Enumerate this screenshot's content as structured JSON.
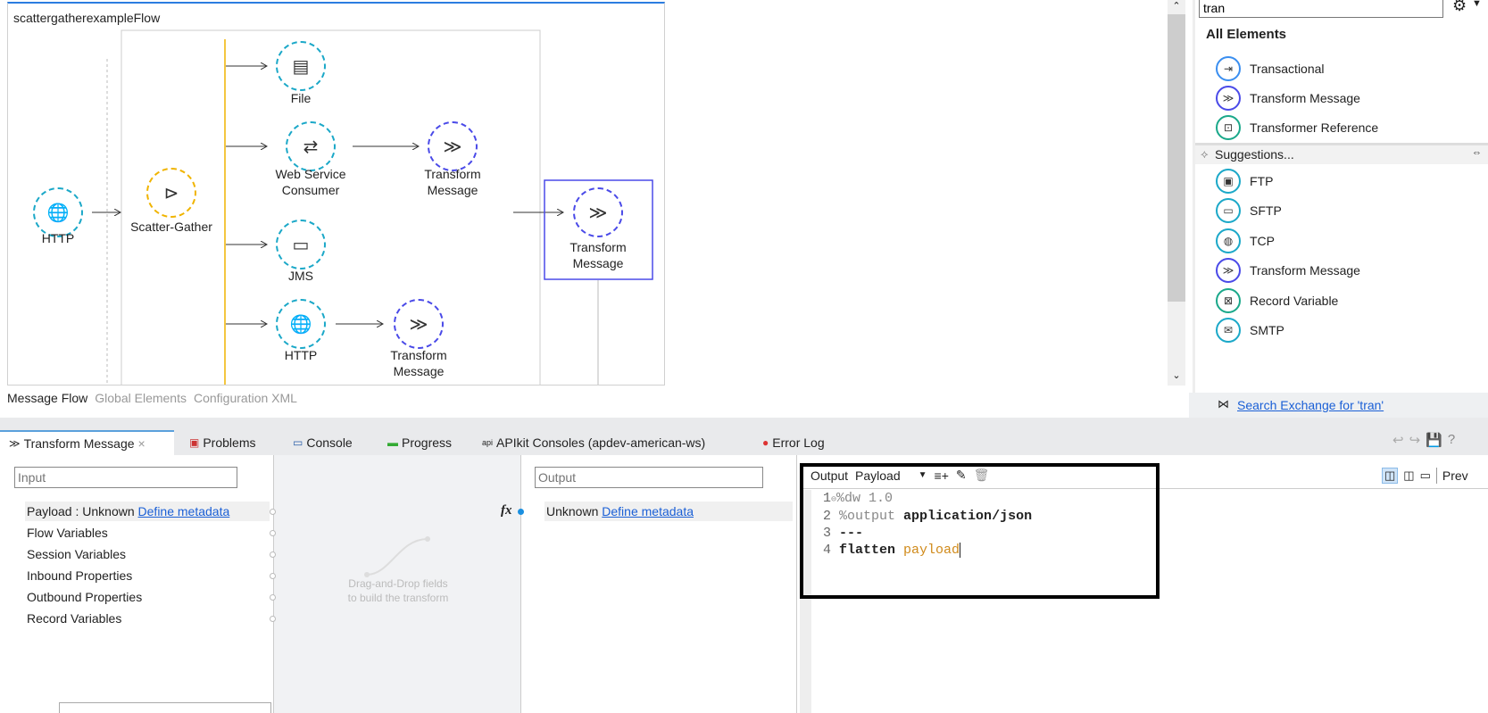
{
  "flow": {
    "title": "scattergatherexampleFlow",
    "nodes": {
      "http": "HTTP",
      "scatter": "Scatter-Gather",
      "file": "File",
      "wsc_1": "Web Service",
      "wsc_2": "Consumer",
      "tm1_1": "Transform",
      "tm1_2": "Message",
      "jms": "JMS",
      "http2": "HTTP",
      "tm2_1": "Transform",
      "tm2_2": "Message",
      "tm3_1": "Transform",
      "tm3_2": "Message"
    },
    "tabs": [
      "Message Flow",
      "Global Elements",
      "Configuration XML"
    ]
  },
  "palette": {
    "search_value": "tran",
    "all_elements_title": "All Elements",
    "all_elements": [
      {
        "label": "Transactional",
        "icon": "transactional-icon"
      },
      {
        "label": "Transform Message",
        "icon": "transform-icon"
      },
      {
        "label": "Transformer Reference",
        "icon": "transformer-reference-icon"
      }
    ],
    "suggestions_title": "Suggestions...",
    "suggestions": [
      {
        "label": "FTP",
        "icon": "ftp-icon"
      },
      {
        "label": "SFTP",
        "icon": "sftp-icon"
      },
      {
        "label": "TCP",
        "icon": "tcp-icon"
      },
      {
        "label": "Transform Message",
        "icon": "transform-icon"
      },
      {
        "label": "Record Variable",
        "icon": "record-variable-icon"
      },
      {
        "label": "SMTP",
        "icon": "smtp-icon"
      }
    ],
    "exchange_link": "Search Exchange for 'tran'"
  },
  "bottom_tabs": [
    "Transform Message",
    "Problems",
    "Console",
    "Progress",
    "APIkit Consoles (apdev-american-ws)",
    "Error Log"
  ],
  "transform": {
    "input_placeholder": "Input",
    "output_placeholder": "Output",
    "payload_label": "Payload : Unknown",
    "define_metadata": "Define metadata",
    "input_items": [
      "Flow Variables",
      "Session Variables",
      "Inbound Properties",
      "Outbound Properties",
      "Record Variables"
    ],
    "drag_hint_1": "Drag-and-Drop fields",
    "drag_hint_2": "to build the transform",
    "fx": "fx",
    "output_unknown": "Unknown",
    "editor_output_label": "Output",
    "editor_target": "Payload",
    "preview_label": "Prev",
    "code": [
      {
        "n": "1",
        "a": "%dw 1.0",
        "b": ""
      },
      {
        "n": "2",
        "a": "%output ",
        "b": "application/json"
      },
      {
        "n": "3",
        "a": "",
        "b": "---"
      },
      {
        "n": "4",
        "a": "flatten ",
        "b": "payload"
      }
    ]
  },
  "colors": {
    "teal": "#1ba8c8",
    "transform": "#4a4ae8",
    "scatter": "#f0b400",
    "link": "#1a5fd6"
  }
}
